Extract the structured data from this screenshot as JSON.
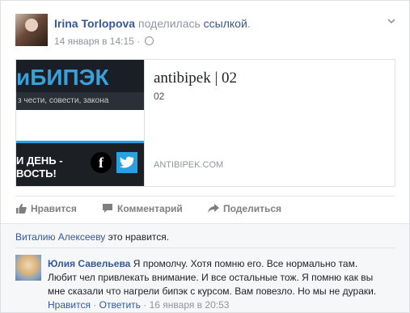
{
  "post": {
    "author": "Irina Torlopova",
    "action": "поделилась",
    "object": "ссылкой",
    "date": "14 января в 14:15",
    "dot": "·"
  },
  "attachment": {
    "brand_text": "иБИПЭК",
    "tagline": "з чести, совести, закона",
    "promo_line1": "И ДЕНЬ -",
    "promo_line2": "ВОСТЬ!",
    "fb_glyph": "f",
    "title": "antibipek | 02",
    "description": "02",
    "domain": "ANTIBIPEK.COM"
  },
  "actions": {
    "like": "Нравится",
    "comment": "Комментарий",
    "share": "Поделиться"
  },
  "likes": {
    "who": "Виталию Алексееву",
    "text": " это нравится."
  },
  "comment": {
    "author": "Юлия Савельева",
    "text": " Я промолчу. Хотя помню его. Все нормально там. Любит чел привлекать внимание. И все остальные тож. Я помню как вы мне сказали что нагрели бипэк с курсом. Вам повезло. Но мы не дураки.",
    "like": "Нравится",
    "reply": "Ответить",
    "sep": " · ",
    "date": "16 января в 20:53"
  },
  "colors": {
    "link": "#365899",
    "muted": "#90949c",
    "twitter": "#2aa0e0",
    "brand": "#3aa0d8"
  },
  "icons": [
    "chevron-down-icon",
    "globe-icon",
    "facebook-icon",
    "twitter-icon",
    "like-icon",
    "comment-icon",
    "share-icon"
  ]
}
